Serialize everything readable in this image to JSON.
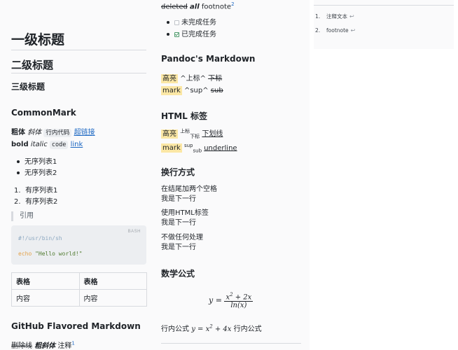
{
  "col1": {
    "h1": "一级标题",
    "h2": "二级标题",
    "h3": "三级标题",
    "commonmark_heading": "CommonMark",
    "inline_cn": {
      "bold": "粗体",
      "italic": "斜体",
      "code": "行内代码",
      "link": "超链接"
    },
    "inline_en": {
      "bold": "bold",
      "italic": "italic",
      "code": "code",
      "link": "link"
    },
    "ul": [
      "无序列表1",
      "无序列表2"
    ],
    "ol": [
      {
        "num": "1.",
        "text": "有序列表1"
      },
      {
        "num": "2.",
        "text": "有序列表2"
      }
    ],
    "quote": "引用",
    "codeblock": {
      "lang": "BASH",
      "line1": "#!/usr/bin/sh",
      "keyword": "echo",
      "string": "\"Hello world!\""
    },
    "table": {
      "headers": [
        "表格",
        "表格"
      ],
      "rows": [
        [
          "内容",
          "内容"
        ]
      ]
    },
    "gfm_heading": "GitHub Flavored Markdown",
    "gfm_line": {
      "del": "删除线",
      "bolditalic": "粗斜体",
      "note": "注释",
      "fn": "1"
    }
  },
  "col2": {
    "top_line": {
      "del": "deleted",
      "bolditalic": "all",
      "text": "footnote",
      "fn": "2"
    },
    "tasks": [
      {
        "text": "未完成任务",
        "done": false
      },
      {
        "text": "已完成任务",
        "done": true
      }
    ],
    "pandoc_heading": "Pandoc's Markdown",
    "pandoc_cn": {
      "mark": "高亮",
      "sup": "^上标^",
      "del": "下标"
    },
    "pandoc_en": {
      "mark": "mark",
      "sup": "^sup^",
      "del": "sub"
    },
    "html_heading": "HTML 标签",
    "html_cn": {
      "mark": "高亮",
      "sup": "上标",
      "sub": "下标",
      "u": "下划线"
    },
    "html_en": {
      "mark": "mark",
      "sup": "sup",
      "sub": "sub",
      "u": "underline"
    },
    "newline_heading": "换行方式",
    "newline_blocks": [
      [
        "在结尾加两个空格",
        "我是下一行"
      ],
      [
        "使用HTML标签",
        "我是下一行"
      ],
      [
        "不做任何处理",
        "我是下一行"
      ]
    ],
    "math_heading": "数学公式",
    "inline_math": {
      "prefix": "行内公式",
      "suffix": "行内公式"
    }
  },
  "col3": {
    "footnotes": [
      {
        "num": "1.",
        "text": "注释文本",
        "back": "↩"
      },
      {
        "num": "2.",
        "text": "footnote",
        "back": "↩"
      }
    ]
  }
}
